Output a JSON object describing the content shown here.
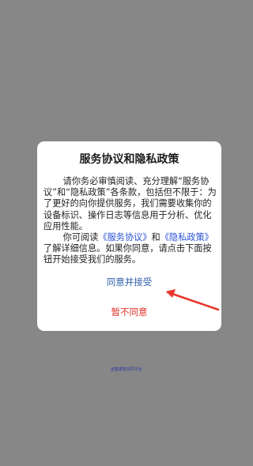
{
  "dialog": {
    "title": "服务协议和隐私政策",
    "para1": "请你务必审慎阅读、充分理解“服务协议”和“隐私政策”各条款，包括但不限于：为了更好的向你提供服务，我们需要收集你的设备标识、操作日志等信息用于分析、优化应用性能。",
    "para2_prefix": "你可阅读",
    "service_agreement_link": "《服务协议》",
    "and_text": "和",
    "privacy_policy_link": "《隐私政策》",
    "para2_suffix": "了解详细信息。如果你同意，请点击下面按钮开始接受我们的服务。",
    "accept_label": "同意并接受",
    "decline_label": "暂不同意"
  },
  "footer": {
    "text": "远集康复协同平台"
  },
  "colors": {
    "overlay": "#878787",
    "link": "#2b52d6",
    "accept": "#2f5fa8",
    "decline": "#e0342c",
    "arrow": "#e8362c"
  }
}
